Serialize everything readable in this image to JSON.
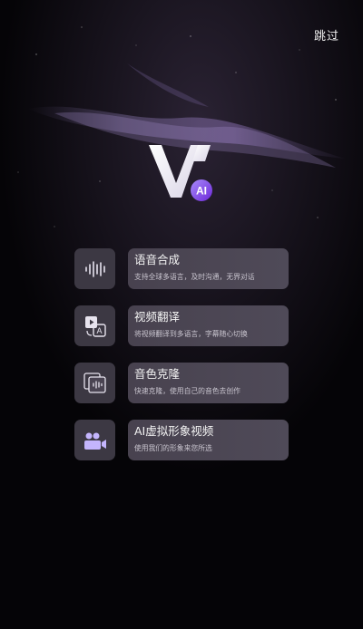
{
  "header": {
    "skip_label": "跳过"
  },
  "logo": {
    "badge_text": "AI"
  },
  "features": [
    {
      "icon": "waveform-icon",
      "title": "语音合成",
      "desc": "支持全球多语言，及时沟通，无界对话"
    },
    {
      "icon": "video-translate-icon",
      "title": "视频翻译",
      "desc": "将视频翻译到多语言，字幕随心切换"
    },
    {
      "icon": "voice-clone-icon",
      "title": "音色克隆",
      "desc": "快速克隆，使用自己的音色去创作"
    },
    {
      "icon": "ai-avatar-icon",
      "title": "AI虚拟形象视频",
      "desc": "使用我们的形象来您所选"
    }
  ],
  "colors": {
    "accent": "#8b5cf6",
    "card": "#4a4452",
    "icon_box": "#3c3843",
    "background": "#050407"
  }
}
